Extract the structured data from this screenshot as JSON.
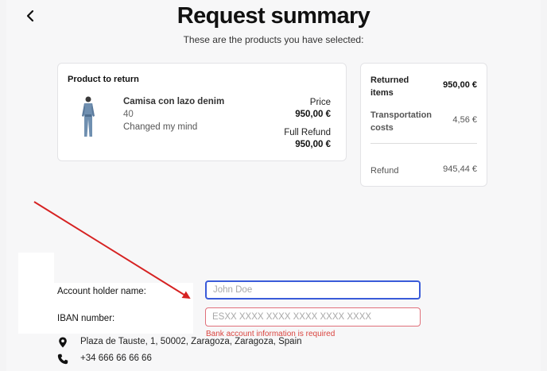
{
  "header": {
    "back_icon": "chevron-left-icon",
    "title": "Request summary",
    "subtitle": "These are the products you have selected:"
  },
  "product_card": {
    "heading": "Product to return",
    "product_name": "Camisa con lazo denim",
    "size": "40",
    "reason": "Changed my mind",
    "price_label": "Price",
    "price_value": "950,00 €",
    "refund_label": "Full Refund",
    "refund_value": "950,00 €"
  },
  "summary_card": {
    "returned_items_label": "Returned items",
    "returned_items_value": "950,00 €",
    "transport_label": "Transportation costs",
    "transport_value": "4,56 €",
    "refund_label": "Refund",
    "refund_value": "945,44 €"
  },
  "form": {
    "holder_label": "Account holder name:",
    "holder_placeholder": "John Doe",
    "holder_value": "",
    "iban_label": "IBAN number:",
    "iban_placeholder": "ESXX XXXX XXXX XXXX XXXX XXXX",
    "iban_value": "",
    "iban_error": "Bank account information is required"
  },
  "contact": {
    "address": "Plaza de Tauste, 1, 50002, Zaragoza, Zaragoza, Spain",
    "address_icon": "map-pin-icon",
    "phone": "+34 666 66 66 66",
    "phone_icon": "phone-icon"
  },
  "colors": {
    "focus_border": "#3a5bd9",
    "error": "#d9443f",
    "annotation_arrow": "#d62222"
  }
}
